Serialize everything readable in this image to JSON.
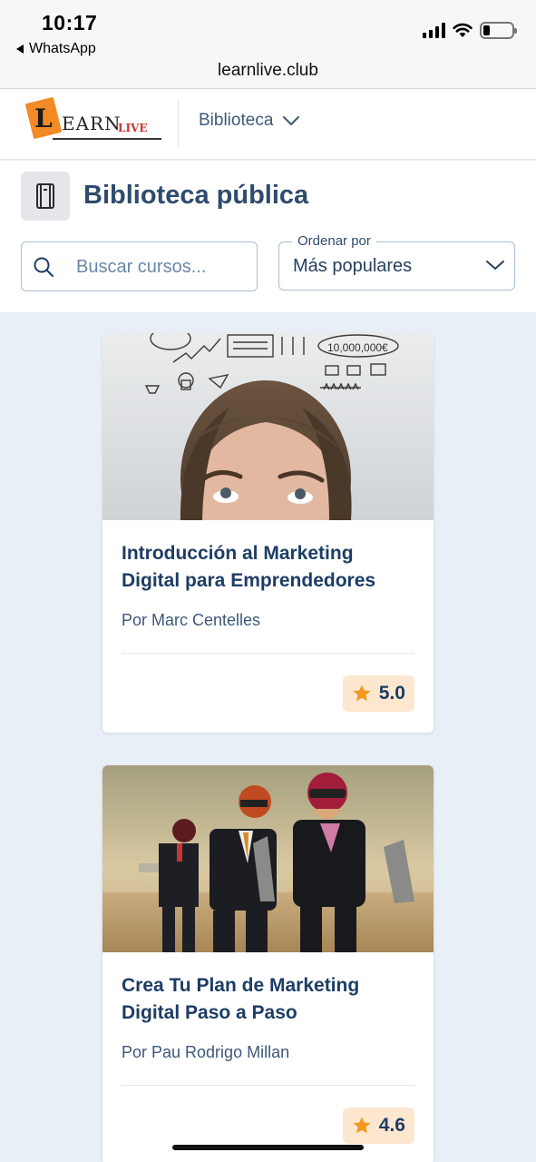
{
  "status_bar": {
    "time": "10:17",
    "back_app": "WhatsApp",
    "url": "learnlive.club",
    "icons": [
      "signal-icon",
      "wifi-icon",
      "battery-icon"
    ]
  },
  "header": {
    "logo_letter": "L",
    "logo_earn": "EARN",
    "logo_live": "LIVE",
    "nav_label": "Biblioteca"
  },
  "library": {
    "title": "Biblioteca pública",
    "search_placeholder": "Buscar cursos...",
    "sort_label": "Ordenar por",
    "sort_value": "Más populares"
  },
  "courses": [
    {
      "title": "Introducción al Marketing Digital para Emprendedores",
      "author": "Por Marc Centelles",
      "rating": "5.0"
    },
    {
      "title": "Crea Tu Plan de Marketing Digital Paso a Paso",
      "author": "Por Pau Rodrigo Millan",
      "rating": "4.6"
    }
  ],
  "colors": {
    "accent_orange": "#f28a26",
    "rating_bg": "#fde7cf",
    "star": "#f29a1f",
    "title_blue": "#1d3d66",
    "page_bg": "#e9eff6"
  }
}
